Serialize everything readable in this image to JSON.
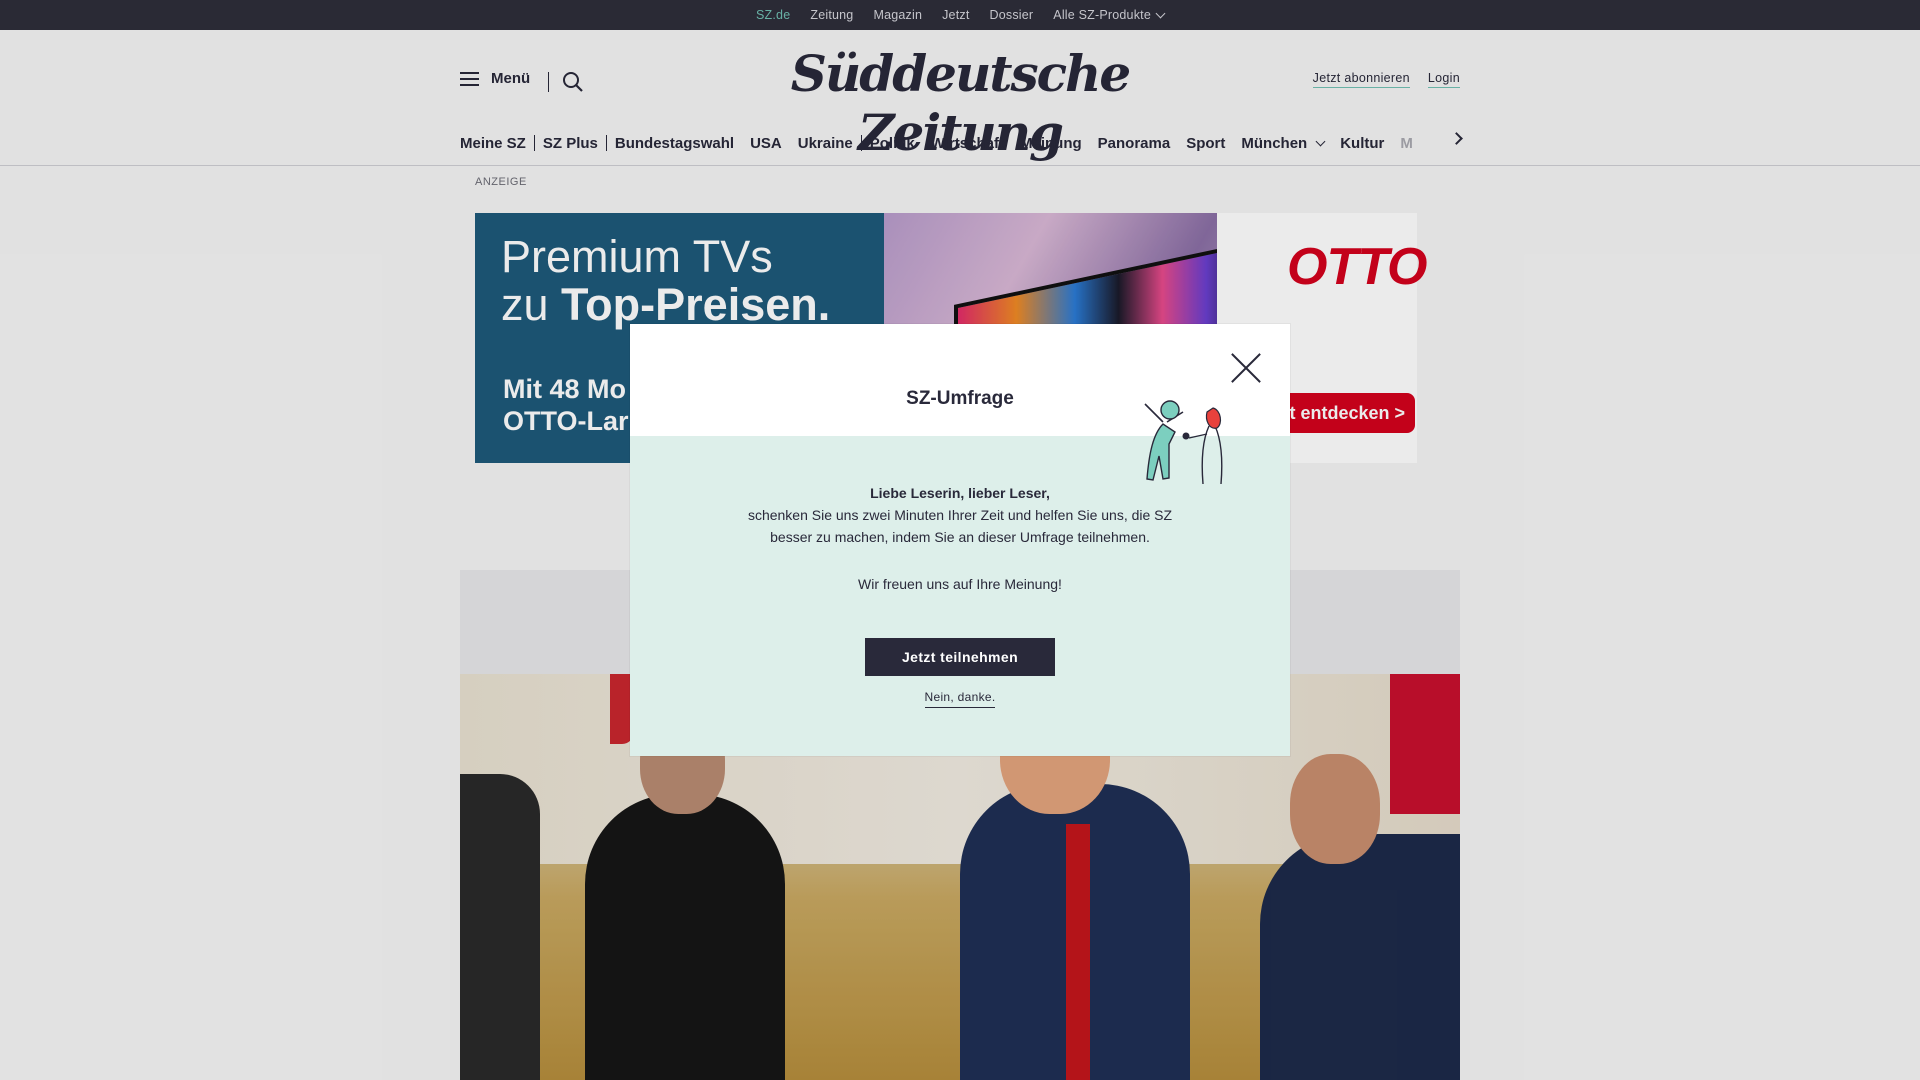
{
  "topbar": {
    "items": [
      {
        "label": "SZ.de",
        "active": true
      },
      {
        "label": "Zeitung"
      },
      {
        "label": "Magazin"
      },
      {
        "label": "Jetzt"
      },
      {
        "label": "Dossier"
      },
      {
        "label": "Alle SZ-Produkte",
        "dropdown": true
      }
    ]
  },
  "header": {
    "menu_label": "Menü",
    "logo_text": "Süddeutsche Zeitung",
    "subscribe_label": "Jetzt abonnieren",
    "login_label": "Login"
  },
  "mainnav": {
    "items": [
      "Meine SZ",
      "SZ Plus",
      "Bundestagswahl",
      "USA",
      "Ukraine",
      "Politik",
      "Wirtschaft",
      "Meinung",
      "Panorama",
      "Sport",
      "München",
      "Kultur",
      "M"
    ]
  },
  "ad": {
    "label": "ANZEIGE",
    "headline_regular": "Premium TVs",
    "headline_line2_prefix": "zu ",
    "headline_bold": "Top-Preisen.",
    "subline": "Mit 48 Mo\nOTTO-Lar",
    "brand": "OTTO",
    "cta": "t entdecken >"
  },
  "modal": {
    "title": "SZ-Umfrage",
    "greeting": "Liebe Leserin, lieber Leser,",
    "message": "schenken Sie uns zwei Minuten Ihrer Zeit und helfen Sie uns, die SZ besser zu machen, indem Sie an dieser Umfrage teilnehmen.",
    "thanks": "Wir freuen uns auf Ihre Meinung!",
    "cta_label": "Jetzt teilnehmen",
    "decline_label": "Nein, danke."
  },
  "colors": {
    "dark": "#29293a",
    "topbar_bg": "#2e2e3a",
    "accent": "#71c0b4",
    "modal_bg": "#ddefea",
    "otto_red": "#d4021d",
    "ad_blue": "#1e5a7a"
  },
  "icons": [
    "hamburger-icon",
    "search-icon",
    "chevron-down-icon",
    "chevron-right-icon",
    "close-icon"
  ]
}
